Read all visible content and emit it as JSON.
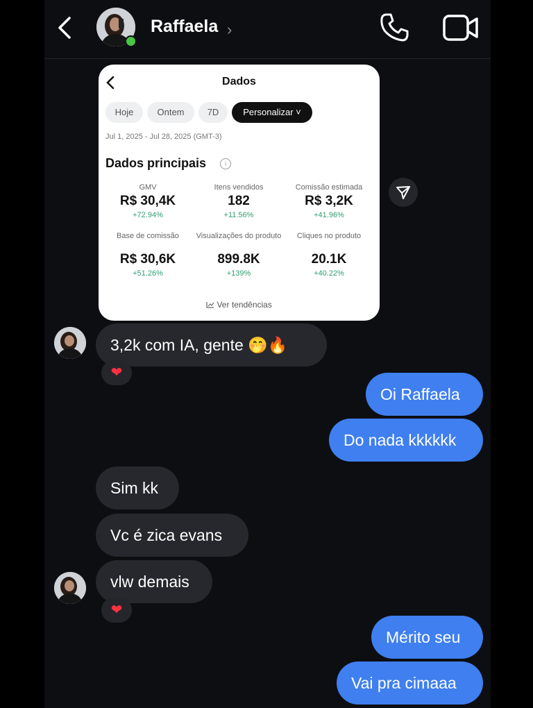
{
  "header": {
    "contact_name": "Raffaela",
    "chevron": "›",
    "icons": [
      "back-chevron-icon",
      "phone-icon",
      "video-camera-icon"
    ],
    "online": true
  },
  "shared_card": {
    "title": "Dados",
    "pills": [
      "Hoje",
      "Ontem",
      "7D",
      "Personalizar ˅"
    ],
    "date_range": "Jul 1, 2025 - Jul 28, 2025 (GMT-3)",
    "section_title": "Dados principais",
    "info_glyph": "i",
    "metrics": [
      {
        "label": "GMV",
        "value": "R$ 30,4K",
        "delta": "+72.94%"
      },
      {
        "label": "Itens vendidos",
        "value": "182",
        "delta": "+11.56%"
      },
      {
        "label": "Comissão estimada",
        "value": "R$ 3,2K",
        "delta": "+41.96%"
      },
      {
        "label": "Base de comissão",
        "value": "R$ 30,6K",
        "delta": "+51.26%"
      },
      {
        "label": "Visualizações do produto",
        "value": "899.8K",
        "delta": "+139%"
      },
      {
        "label": "Cliques no produto",
        "value": "20.1K",
        "delta": "+40.22%"
      }
    ],
    "trend_link": "Ver tendências"
  },
  "messages": [
    {
      "from": "them",
      "text": "3,2k com IA, gente 🤭🔥",
      "reaction": "❤"
    },
    {
      "from": "me",
      "text": "Oi Raffaela"
    },
    {
      "from": "me",
      "text": "Do nada kkkkkk"
    },
    {
      "from": "them",
      "text": "Sim kk"
    },
    {
      "from": "them",
      "text": "Vc é zica evans"
    },
    {
      "from": "them",
      "text": "vlw demais",
      "reaction": "❤"
    },
    {
      "from": "me",
      "text": "Mérito seu"
    },
    {
      "from": "me",
      "text": "Vai pra cimaaa"
    }
  ],
  "colors": {
    "outgoing_bubble": "#3f7ff0",
    "incoming_bubble": "#26282d",
    "background": "#0d0e12",
    "online": "#45c744"
  }
}
